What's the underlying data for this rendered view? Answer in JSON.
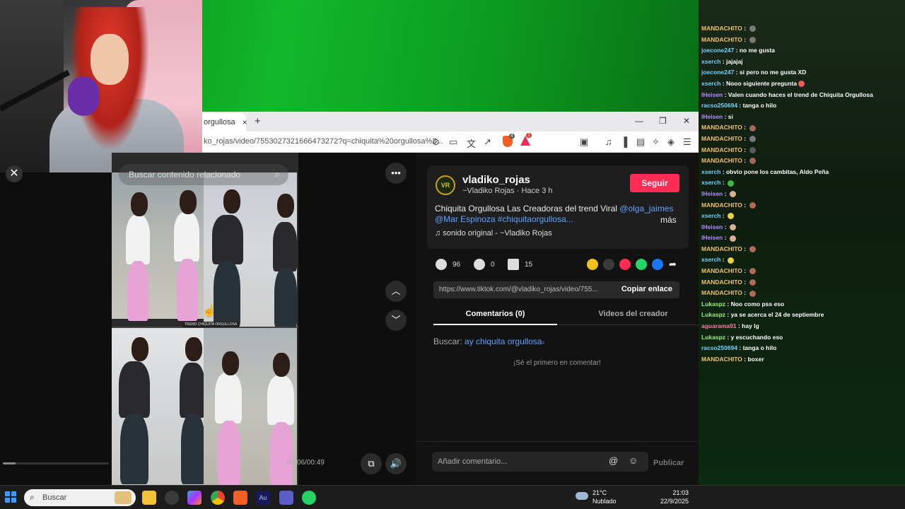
{
  "browser": {
    "tab_title": "orgullosa",
    "tab_close": "×",
    "new_tab": "+",
    "minimize": "—",
    "maximize": "❐",
    "close": "✕",
    "url": "ko_rojas/video/7553027321666473272?q=chiquita%20orgullosa%2..."
  },
  "video": {
    "search_placeholder": "Buscar contenido relacionado",
    "caption": "TREND CHIQUITA ORGULLOSA",
    "timecode": "00:06/00:49",
    "progress": 0.12
  },
  "post": {
    "avatar": "VR",
    "username": "vladiko_rojas",
    "subtitle": "~Vladiko Rojas · Hace 3 h",
    "follow": "Seguir",
    "desc_text": "Chiquita Orgullosa Las Creadoras del trend Viral ",
    "desc_tag1": "@olga_jaimes",
    "desc_tag2": "@Mar Espinoza #chiquitaorgullosa...",
    "more": "más",
    "sound": "♫  sonido original - ~Vladiko Rojas",
    "likes": "96",
    "comments": "0",
    "saves": "15",
    "link": "https://www.tiktok.com/@vladiko_rojas/video/755...",
    "copy": "Copiar enlace",
    "tab_comments": "Comentarios (0)",
    "tab_videos": "Videos del creador",
    "search_label": "Buscar: ",
    "search_query": "ay chiquita orgullosa",
    "empty": "¡Sé el primero en comentar!",
    "comment_placeholder": "Añadir comentario...",
    "publish": "Publicar"
  },
  "chat": [
    {
      "user": "MANDACHITO",
      "color": "#f0c070",
      "text": " : ",
      "emote": "#7a7a7a"
    },
    {
      "user": "MANDACHITO",
      "color": "#f0c070",
      "text": " : ",
      "emote": "#7a7a7a"
    },
    {
      "user": "joecone247",
      "color": "#6fd2ff",
      "text": " : no me gusta",
      "emote": ""
    },
    {
      "user": "xserch",
      "color": "#6fd2ff",
      "text": " : jajajaj",
      "emote": ""
    },
    {
      "user": "joecone247",
      "color": "#6fd2ff",
      "text": " : si pero no me gusta XD",
      "emote": ""
    },
    {
      "user": "xserch",
      "color": "#6fd2ff",
      "text": " : Nooo siguiente pregunta",
      "emote": "#f05a5a"
    },
    {
      "user": "lHeisen",
      "color": "#b58cff",
      "text": " : Valen cuando haces el trend de Chiquita Orgullosa",
      "emote": ""
    },
    {
      "user": "racso250694",
      "color": "#6fd2ff",
      "text": " : tanga o hilo",
      "emote": ""
    },
    {
      "user": "lHeisen",
      "color": "#b58cff",
      "text": " : si",
      "emote": ""
    },
    {
      "user": "MANDACHITO",
      "color": "#f0c070",
      "text": " : ",
      "emote": "#a06a5a"
    },
    {
      "user": "MANDACHITO",
      "color": "#f0c070",
      "text": " : ",
      "emote": "#7a7a7a"
    },
    {
      "user": "MANDACHITO",
      "color": "#f0c070",
      "text": " : ",
      "emote": "#5a5a5a"
    },
    {
      "user": "MANDACHITO",
      "color": "#f0c070",
      "text": " : ",
      "emote": "#a06a5a"
    },
    {
      "user": "xserch",
      "color": "#6fd2ff",
      "text": " : obvio pone los cambitas, Aldo Peña",
      "emote": ""
    },
    {
      "user": "xserch",
      "color": "#6fd2ff",
      "text": " : ",
      "emote": "#3ab84a"
    },
    {
      "user": "lHeisen",
      "color": "#b58cff",
      "text": " : ",
      "emote": "#d8b090"
    },
    {
      "user": "MANDACHITO",
      "color": "#f0c070",
      "text": " : ",
      "emote": "#b06a5a"
    },
    {
      "user": "xserch",
      "color": "#6fd2ff",
      "text": " : ",
      "emote": "#e8d040"
    },
    {
      "user": "lHeisen",
      "color": "#b58cff",
      "text": " : ",
      "emote": "#d8b090"
    },
    {
      "user": "lHeisen",
      "color": "#b58cff",
      "text": " : ",
      "emote": "#d8b090"
    },
    {
      "user": "MANDACHITO",
      "color": "#f0c070",
      "text": " : ",
      "emote": "#b06a5a"
    },
    {
      "user": "xserch",
      "color": "#6fd2ff",
      "text": " : ",
      "emote": "#e8d040"
    },
    {
      "user": "MANDACHITO",
      "color": "#f0c070",
      "text": " : ",
      "emote": "#b06a5a"
    },
    {
      "user": "MANDACHITO",
      "color": "#f0c070",
      "text": " : ",
      "emote": "#b06a5a"
    },
    {
      "user": "MANDACHITO",
      "color": "#f0c070",
      "text": " : ",
      "emote": "#b06a5a"
    },
    {
      "user": "Lukaspz",
      "color": "#9ff06f",
      "text": " : Noo como pss eso",
      "emote": ""
    },
    {
      "user": "Lukaspz",
      "color": "#9ff06f",
      "text": " : ya se acerca el 24 de septiembre",
      "emote": ""
    },
    {
      "user": "aguarama91",
      "color": "#ff7aa8",
      "text": " : hay lg",
      "emote": ""
    },
    {
      "user": "Lukaspz",
      "color": "#9ff06f",
      "text": " : y escuchando eso",
      "emote": ""
    },
    {
      "user": "racso250694",
      "color": "#6fd2ff",
      "text": " : tanga o hilo",
      "emote": ""
    },
    {
      "user": "MANDACHITO",
      "color": "#f0c070",
      "text": " : boxer",
      "emote": ""
    }
  ],
  "taskbar": {
    "search_placeholder": "Buscar",
    "temp": "21°C",
    "weather": "Nublado",
    "time": "21:03",
    "date": "22/9/2025"
  },
  "colors": {
    "accent": "#fe2c55",
    "link": "#5ea3ff"
  }
}
